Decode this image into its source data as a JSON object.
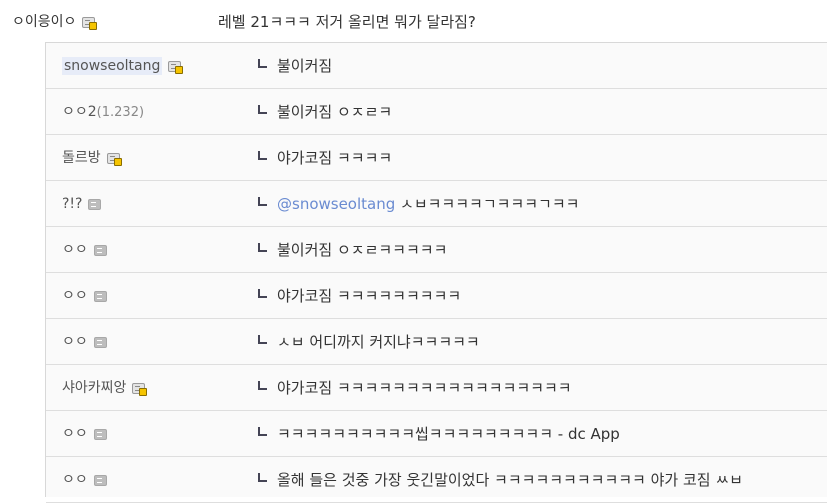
{
  "post": {
    "nick": "ㅇ이응이ㅇ",
    "title": "레벨 21ㅋㅋㅋ 저거 올리면 뭐가 달라짐?"
  },
  "replies": [
    {
      "nick": "snowseoltang",
      "highlight": true,
      "icon": "gold",
      "text": "불이커짐"
    },
    {
      "nick": "ㅇㅇ2",
      "ip": "(1.232)",
      "icon": "",
      "text": "불이커짐 ㅇㅈㄹㅋ"
    },
    {
      "nick": "돌르방",
      "icon": "gold",
      "text": "야가코짐 ㅋㅋㅋㅋ"
    },
    {
      "nick": "?!?",
      "icon": "gray",
      "mention": "@snowseoltang",
      "text": " ㅅㅂㅋㅋㅋㅋㄱㅋㅋㅋㄱㅋㅋ"
    },
    {
      "nick": "ㅇㅇ",
      "icon": "gray",
      "text": "불이커짐 ㅇㅈㄹㅋㅋㅋㅋㅋ"
    },
    {
      "nick": "ㅇㅇ",
      "icon": "gray",
      "text": "야가코짐 ㅋㅋㅋㅋㅋㅋㅋㅋㅋ"
    },
    {
      "nick": "ㅇㅇ",
      "icon": "gray",
      "text": "ㅅㅂ 어디까지 커지냐ㅋㅋㅋㅋㅋ"
    },
    {
      "nick": "샤아카찌앙",
      "icon": "gold",
      "text": "야가코짐 ㅋㅋㅋㅋㅋㅋㅋㅋㅋㅋㅋㅋㅋㅋㅋㅋㅋ"
    },
    {
      "nick": "ㅇㅇ",
      "icon": "gray",
      "text": "ㅋㅋㅋㅋㅋㅋㅋㅋㅋㅋ씹ㅋㅋㅋㅋㅋㅋㅋㅋㅋ - dc App"
    },
    {
      "nick": "ㅇㅇ",
      "icon": "gray",
      "text": "올해 들은 것중 가장 웃긴말이었다 ㅋㅋㅋㅋㅋㅋㅋㅋㅋㅋㅋ 야가 코짐 ㅆㅂ"
    }
  ]
}
